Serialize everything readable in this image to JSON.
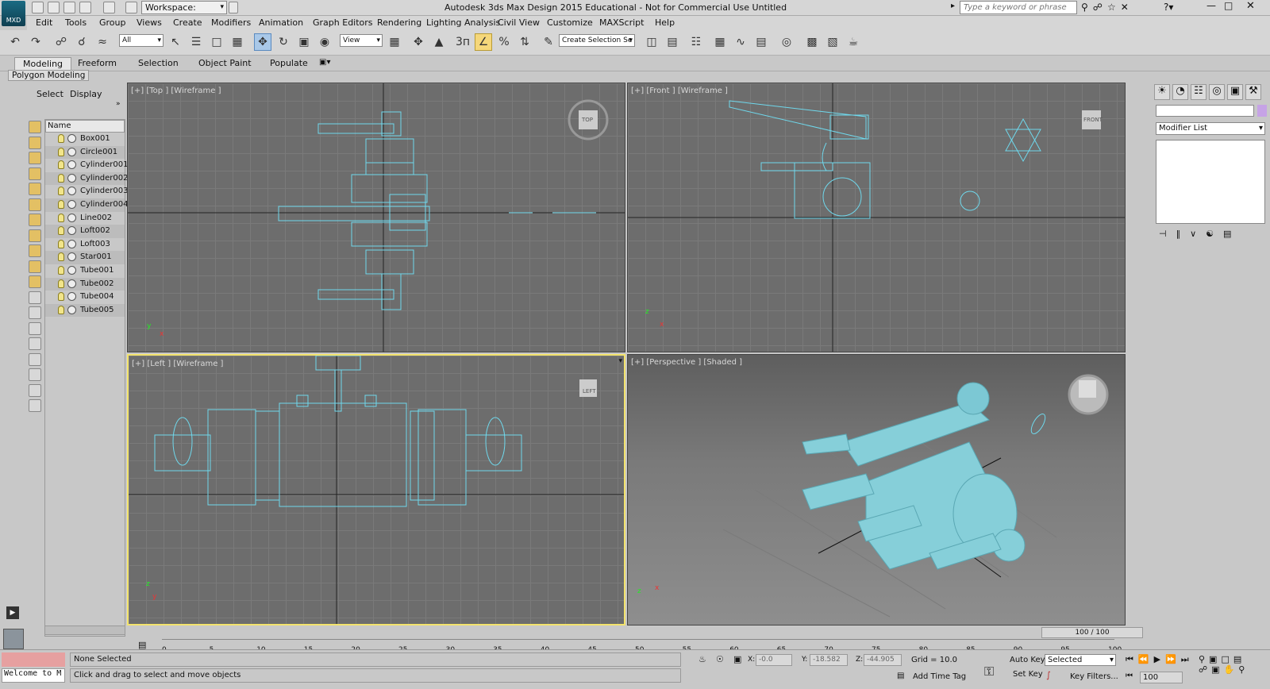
{
  "app": {
    "title": "Autodesk 3ds Max Design 2015  Educational - Not for Commercial Use    Untitled",
    "logo_text": "MXD",
    "workspace": "Workspace: Default",
    "search_placeholder": "Type a keyword or phrase"
  },
  "menu": [
    "Edit",
    "Tools",
    "Group",
    "Views",
    "Create",
    "Modifiers",
    "Animation",
    "Graph Editors",
    "Rendering",
    "Lighting Analysis",
    "Civil View",
    "Customize",
    "MAXScript",
    "Help"
  ],
  "toolbar": {
    "filter": "All",
    "ref_coord": "View",
    "selection_set": "Create Selection Se",
    "snap_label": "3"
  },
  "ribbon": {
    "tabs": [
      "Modeling",
      "Freeform",
      "Selection",
      "Object Paint",
      "Populate"
    ],
    "subtitle": "Polygon Modeling"
  },
  "scene_explorer": {
    "tabs": [
      "Select",
      "Display"
    ],
    "column": "Name",
    "objects": [
      "Box001",
      "Circle001",
      "Cylinder001",
      "Cylinder002",
      "Cylinder003",
      "Cylinder004",
      "Line002",
      "Loft002",
      "Loft003",
      "Star001",
      "Tube001",
      "Tube002",
      "Tube004",
      "Tube005"
    ]
  },
  "viewports": {
    "top": {
      "label": "[+] [Top ] [Wireframe ]",
      "cube": "TOP"
    },
    "front": {
      "label": "[+] [Front ] [Wireframe ]",
      "cube": "FRONT"
    },
    "left": {
      "label": "[+] [Left ] [Wireframe ]",
      "cube": "LEFT"
    },
    "persp": {
      "label": "[+] [Perspective ] [Shaded ]"
    }
  },
  "command_panel": {
    "modifier_list": "Modifier List"
  },
  "timeline": {
    "frame": "100 / 100",
    "ticks": [
      "0",
      "5",
      "10",
      "15",
      "20",
      "25",
      "30",
      "35",
      "40",
      "45",
      "50",
      "55",
      "60",
      "65",
      "70",
      "75",
      "80",
      "85",
      "90",
      "95",
      "100"
    ]
  },
  "status": {
    "selection": "None Selected",
    "prompt": "Click and drag to select and move objects",
    "listener": "Welcome to M",
    "x_label": "X:",
    "x_val": "-0.0",
    "y_label": "Y:",
    "y_val": "-18.582",
    "z_label": "Z:",
    "z_val": "-44.905",
    "grid": "Grid = 10.0",
    "add_time_tag": "Add Time Tag",
    "auto_key": "Auto Key",
    "set_key": "Set Key",
    "key_mode": "Selected",
    "key_filters": "Key Filters...",
    "frame_field": "100"
  },
  "colors": {
    "wire": "#6fd8ec",
    "model": "#8ad5de",
    "selected_border": "#f3e36d"
  }
}
